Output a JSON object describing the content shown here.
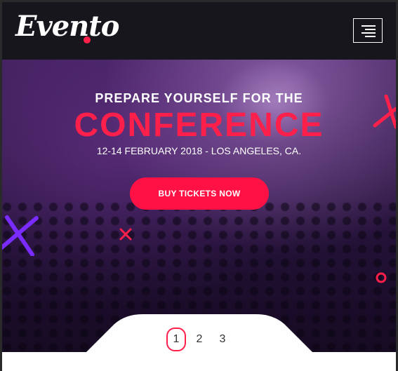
{
  "header": {
    "logo_text": "Evento",
    "menu_icon": "hamburger-menu-icon",
    "background": "#17161c"
  },
  "hero": {
    "pre_title": "PREPARE YOURSELF FOR THE",
    "title": "CONFERENCE",
    "date_location": "12-14 FEBRUARY 2018 - LOS ANGELES, CA.",
    "cta_label": "BUY TICKETS NOW",
    "accent_color": "#ff1f4b"
  },
  "pagination": {
    "pages": [
      "1",
      "2",
      "3"
    ],
    "active_index": 0
  }
}
